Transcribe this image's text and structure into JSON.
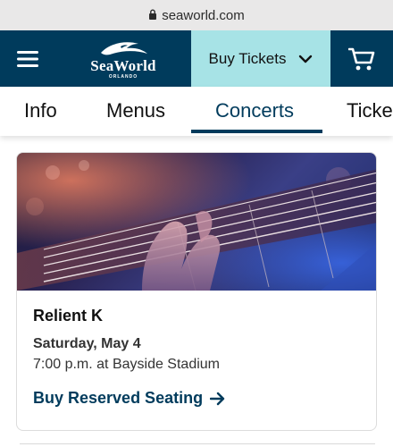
{
  "browser": {
    "url": "seaworld.com"
  },
  "header": {
    "logo_text": "SeaWorld",
    "logo_subtext": "ORLANDO",
    "buy_tickets_label": "Buy Tickets"
  },
  "tabs": [
    {
      "label": "Info"
    },
    {
      "label": "Menus"
    },
    {
      "label": "Concerts"
    },
    {
      "label": "Ticke"
    }
  ],
  "event": {
    "title": "Relient K",
    "date": "Saturday, May 4",
    "time_location": "7:00 p.m. at Bayside Stadium",
    "cta_label": "Buy Reserved Seating"
  },
  "colors": {
    "brand_navy": "#003b5c",
    "accent_aqua": "#a7e3e6"
  }
}
